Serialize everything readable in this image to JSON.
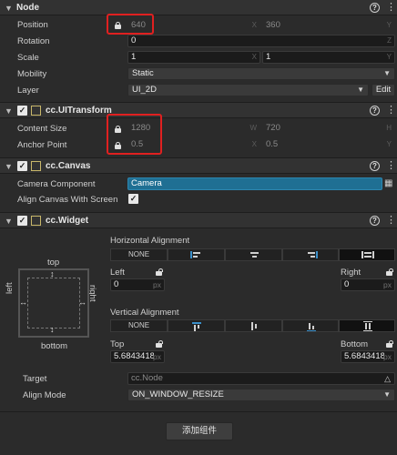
{
  "node": {
    "header": "Node",
    "help": "?",
    "menu": "⋮",
    "position_label": "Position",
    "position_x": "640",
    "position_y": "360",
    "rotation_label": "Rotation",
    "rotation_value": "0",
    "scale_label": "Scale",
    "scale_x": "1",
    "scale_y": "1",
    "mobility_label": "Mobility",
    "mobility_value": "Static",
    "layer_label": "Layer",
    "layer_value": "UI_2D",
    "edit_label": "Edit",
    "axis_x": "X",
    "axis_y": "Y",
    "axis_z": "Z"
  },
  "uitransform": {
    "header": "cc.UITransform",
    "content_size_label": "Content Size",
    "width": "1280",
    "height": "720",
    "axis_w": "W",
    "axis_h": "H",
    "anchor_label": "Anchor Point",
    "anchor_x": "0.5",
    "anchor_y": "0.5",
    "axis_x": "X",
    "axis_y": "Y"
  },
  "canvas": {
    "header": "cc.Canvas",
    "camera_label": "Camera Component",
    "camera_value": "Camera",
    "align_label": "Align Canvas With Screen",
    "align_checked": true
  },
  "widget": {
    "header": "cc.Widget",
    "diagram_top": "top",
    "diagram_left": "left",
    "diagram_right": "right",
    "diagram_bottom": "bottom",
    "horizontal_label": "Horizontal Alignment",
    "vertical_label": "Vertical Alignment",
    "none_label": "NONE",
    "left_label": "Left",
    "left_value": "0",
    "right_label": "Right",
    "right_value": "0",
    "top_label": "Top",
    "top_value": "5.6843418",
    "bottom_label": "Bottom",
    "bottom_value": "5.6843418",
    "unit_px": "px",
    "target_label": "Target",
    "target_value": "cc.Node",
    "align_mode_label": "Align Mode",
    "align_mode_value": "ON_WINDOW_RESIZE"
  },
  "add_component_label": "添加组件",
  "check_mark": "✓",
  "chevron_down": "⌄"
}
